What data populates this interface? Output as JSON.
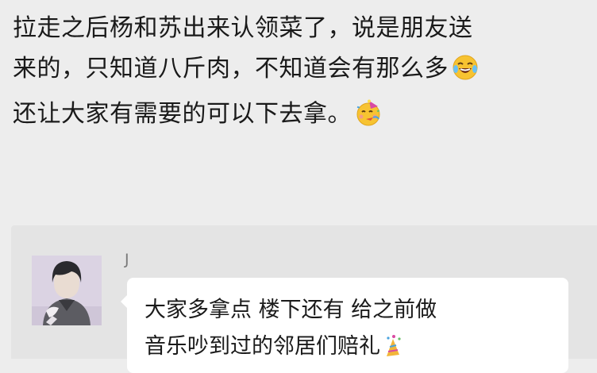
{
  "post": {
    "line1": "拉走之后杨和苏出来认领菜了，说是朋友送",
    "line2": "来的，只知道八斤肉，不知道会有那么多",
    "line3": "还让大家有需要的可以下去拿。",
    "emoji_after_line2": "face-with-tears-of-joy-icon",
    "emoji_after_line3": "partying-face-icon"
  },
  "chat": {
    "sender_name": "J",
    "message_line1": "大家多拿点 楼下还有 给之前做",
    "message_line2": "音乐吵到过的邻居们赔礼",
    "message_emoji": "party-popper-icon",
    "colors": {
      "panel_background": "#e4e4e4",
      "bubble_background": "#ffffff",
      "name_color": "#7a7a7a"
    }
  }
}
